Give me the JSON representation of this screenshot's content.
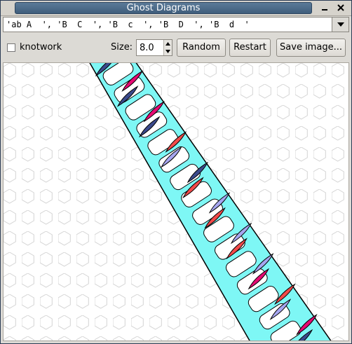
{
  "window": {
    "title": "Ghost Diagrams"
  },
  "combo": {
    "value": "'ab A  ', 'B  C  ', 'B  c  ', 'B  D  ', 'B  d  '"
  },
  "toolbar": {
    "knotwork_label": "knotwork",
    "knotwork_checked": false,
    "size_label": "Size:",
    "size_value": "8.0",
    "random_label": "Random",
    "restart_label": "Restart",
    "save_label": "Save image..."
  },
  "colors": {
    "band_fill": "#7ef7f5",
    "grid_line": "#d4d4d4",
    "accents": [
      "#3b4a8c",
      "#e60a73",
      "#f24a4a",
      "#a6a6f0"
    ]
  },
  "icons": [
    "minimize-icon",
    "close-icon",
    "chevron-down-icon",
    "spin-up-icon",
    "spin-down-icon"
  ]
}
